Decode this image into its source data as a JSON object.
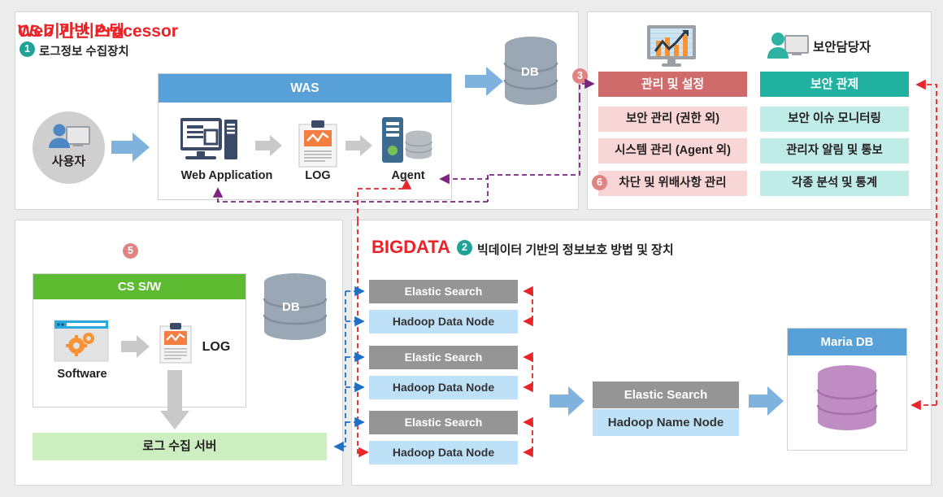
{
  "panels": {
    "web": {
      "title": "Web 기반 Processor",
      "badge": "1",
      "subtitle": "로그정보 수집장치",
      "user_label": "사용자",
      "was_title": "WAS",
      "nodes": [
        {
          "label": "Web Application",
          "icon": "monitor-server-icon"
        },
        {
          "label": "LOG",
          "icon": "clipboard-chart-icon"
        },
        {
          "label": "Agent",
          "icon": "server-database-icon"
        }
      ],
      "db_label": "DB"
    },
    "admin": {
      "security_officer_label": "보안담당자",
      "chart_monitor_icon": "chart-monitor-icon",
      "person_monitor_icon": "person-monitor-icon",
      "columns": [
        {
          "head": "관리 및 설정",
          "head_color": "#cf6b6b",
          "badge": "3",
          "items": [
            {
              "label": "보안 관리 (권한 외)"
            },
            {
              "label": "시스템 관리 (Agent 외)"
            },
            {
              "label": "차단 및 위배사항 관리",
              "badge": "6"
            }
          ]
        },
        {
          "head": "보안 관제",
          "head_color": "#21b1a0",
          "items": [
            {
              "label": "보안 이슈 모니터링"
            },
            {
              "label": "관리자 알림 및 통보"
            },
            {
              "label": "각종 분석 및 통계"
            }
          ]
        }
      ]
    },
    "cs": {
      "title": "CS 기반 시스템",
      "badge": "5",
      "box_title": "CS S/W",
      "software_label": "Software",
      "log_label": "LOG",
      "db_label": "DB",
      "log_server_label": "로그 수집 서버"
    },
    "bigdata": {
      "title": "BIGDATA",
      "badge": "2",
      "subtitle": "빅데이터 기반의 정보보호 방법 및 장치",
      "node_pairs": [
        {
          "elastic": "Elastic Search",
          "hadoop": "Hadoop Data Node"
        },
        {
          "elastic": "Elastic Search",
          "hadoop": "Hadoop Data Node"
        },
        {
          "elastic": "Elastic Search",
          "hadoop": "Hadoop Data Node"
        }
      ],
      "master": {
        "elastic": "Elastic Search",
        "hadoop": "Hadoop Name Node"
      },
      "maria": {
        "title": "Maria DB"
      }
    }
  },
  "colors": {
    "title_red": "#ec2227",
    "badge_teal": "#21a297",
    "badge_red": "#e08383",
    "header_blue": "#57a0d8",
    "header_green": "#5dbb32",
    "elastic_gray": "#959595",
    "hadoop_blue": "#bfe1f7",
    "flow_arrow_blue": "#7fb3de",
    "dashed_red": "#e8252a",
    "dashed_blue": "#1f6fc4",
    "dashed_purple": "#7b2480"
  }
}
